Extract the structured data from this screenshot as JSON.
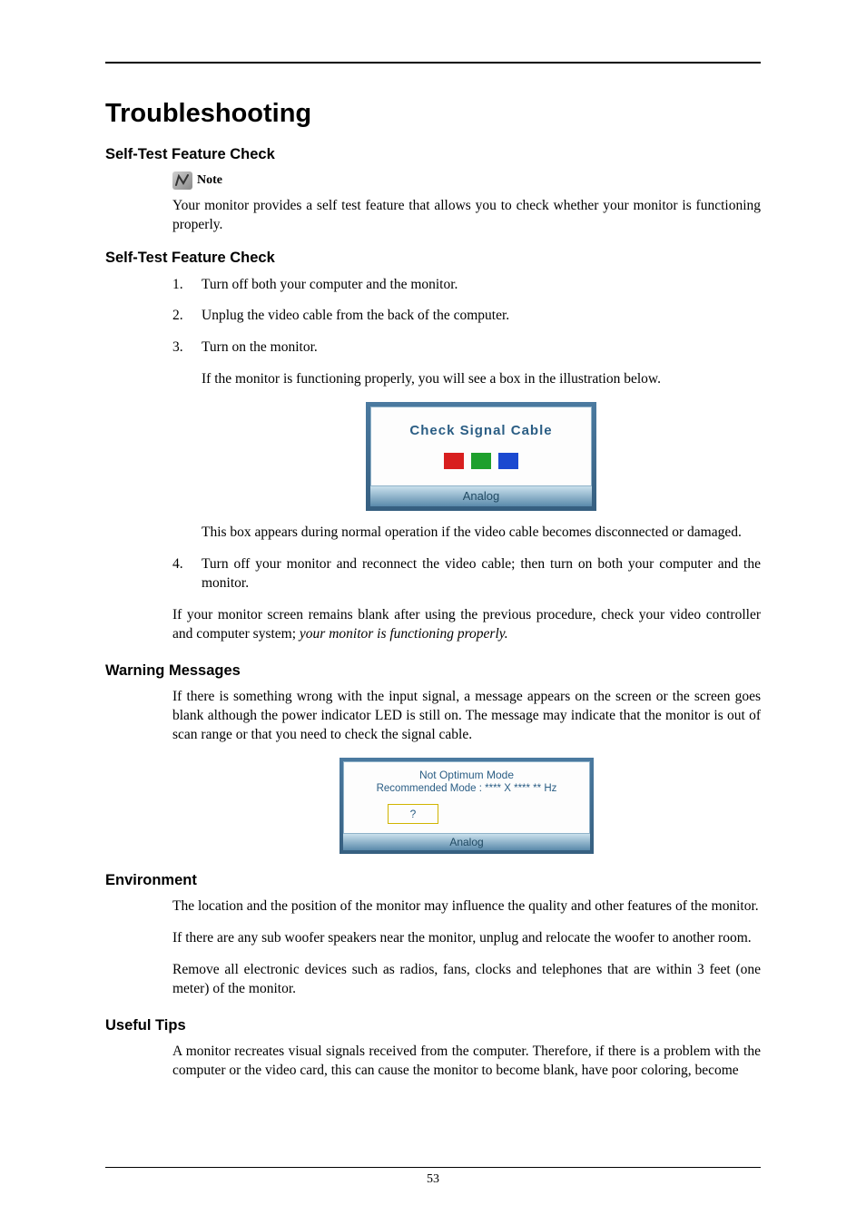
{
  "h1": "Troubleshooting",
  "sections": {
    "s1": {
      "heading": "Self-Test Feature Check",
      "note_label": "Note",
      "note_body": "Your monitor provides a self test feature that allows you to check whether your monitor is functioning properly."
    },
    "s2": {
      "heading": "Self-Test Feature Check",
      "steps": {
        "a": "Turn off both your computer and the monitor.",
        "b": "Unplug the video cable from the back of the computer.",
        "c": "Turn on the monitor.",
        "c_sub": "If the monitor is functioning properly, you will see a box in the illustration below.",
        "c_after": "This box appears during normal operation if the video cable becomes disconnected or damaged.",
        "d": "Turn off your monitor and reconnect the video cable; then turn on both your computer and the monitor."
      },
      "tail_a": "If your monitor screen remains blank after using the previous procedure, check your video controller and computer system; ",
      "tail_b": "your monitor is functioning properly."
    },
    "s3": {
      "heading": "Warning Messages",
      "body": "If there is something wrong with the input signal, a message appears on the screen or the screen goes blank although the power indicator LED is still on. The message may indicate that the monitor is out of scan range or that you need to check the signal cable."
    },
    "s4": {
      "heading": "Environment",
      "p1": "The location and the position of the monitor may influence the quality and other features of the monitor.",
      "p2": "If there are any sub woofer speakers near the monitor, unplug and relocate the woofer to another room.",
      "p3": "Remove all electronic devices such as radios, fans, clocks and telephones that are within 3 feet (one meter) of the monitor."
    },
    "s5": {
      "heading": "Useful Tips",
      "p1": "A monitor recreates visual signals received from the computer. Therefore, if there is a problem with the computer or the video card, this can cause the monitor to become blank, have poor coloring, become"
    }
  },
  "fig1": {
    "title": "Check Signal Cable",
    "footer": "Analog"
  },
  "fig2": {
    "line1": "Not Optimum Mode",
    "line2": "Recommended Mode : **** X **** ** Hz",
    "q": "?",
    "footer": "Analog"
  },
  "page_number": "53"
}
